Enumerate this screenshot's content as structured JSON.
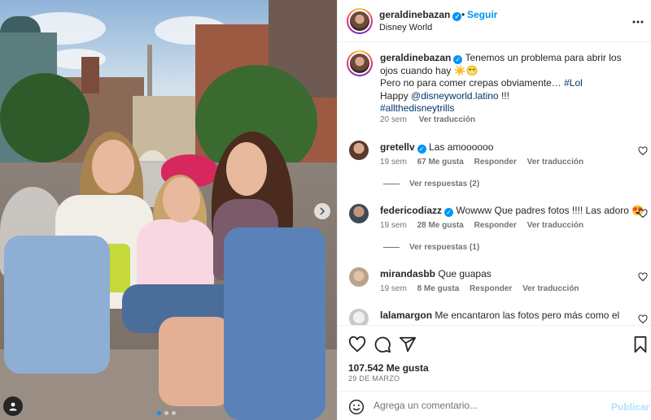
{
  "post": {
    "username": "geraldinebazan",
    "separator": "•",
    "follow_label": "Seguir",
    "location": "Disney World",
    "more_icon": "more-horizontal-icon"
  },
  "caption": {
    "username": "geraldinebazan",
    "line1": "Tenemos un problema para abrir los ojos cuando hay ☀️😁",
    "line2": "Pero no para comer crepas obviamente… ",
    "hashtag1": "#Lol",
    "line3_prefix": "Happy ",
    "mention": "@disneyworld.latino",
    "line3_suffix": " !!!",
    "hashtag2": "#allthedisneytrills",
    "time": "20 sem",
    "translate": "Ver traducción"
  },
  "comments": [
    {
      "username": "gretellv",
      "verified": true,
      "text": "Las amoooooo",
      "time": "19 sem",
      "likes": "67 Me gusta",
      "reply": "Responder",
      "translate": "Ver traducción",
      "replies": "Ver respuestas (2)"
    },
    {
      "username": "federicodiazz",
      "verified": true,
      "text": "Wowww Que padres fotos !!!! Las adoro 😍",
      "time": "19 sem",
      "likes": "28 Me gusta",
      "reply": "Responder",
      "translate": "Ver traducción",
      "replies": "Ver respuestas (1)"
    },
    {
      "username": "mirandasbb",
      "verified": false,
      "text": "Que guapas",
      "time": "19 sem",
      "likes": "8 Me gusta",
      "reply": "Responder",
      "translate": "Ver traducción"
    },
    {
      "username": "lalamargon",
      "verified": false,
      "text": "Me encantaron las fotos pero más como el"
    }
  ],
  "footer": {
    "likes": "107.542 Me gusta",
    "date": "29 DE MARZO",
    "comment_placeholder": "Agrega un comentario...",
    "publish_label": "Publicar"
  },
  "carousel": {
    "current": 1,
    "total": 3
  },
  "colors": {
    "accent": "#0095f6",
    "text": "#262626",
    "secondary": "#737373",
    "link": "#00376b",
    "publish_disabled": "#b2dffc"
  }
}
